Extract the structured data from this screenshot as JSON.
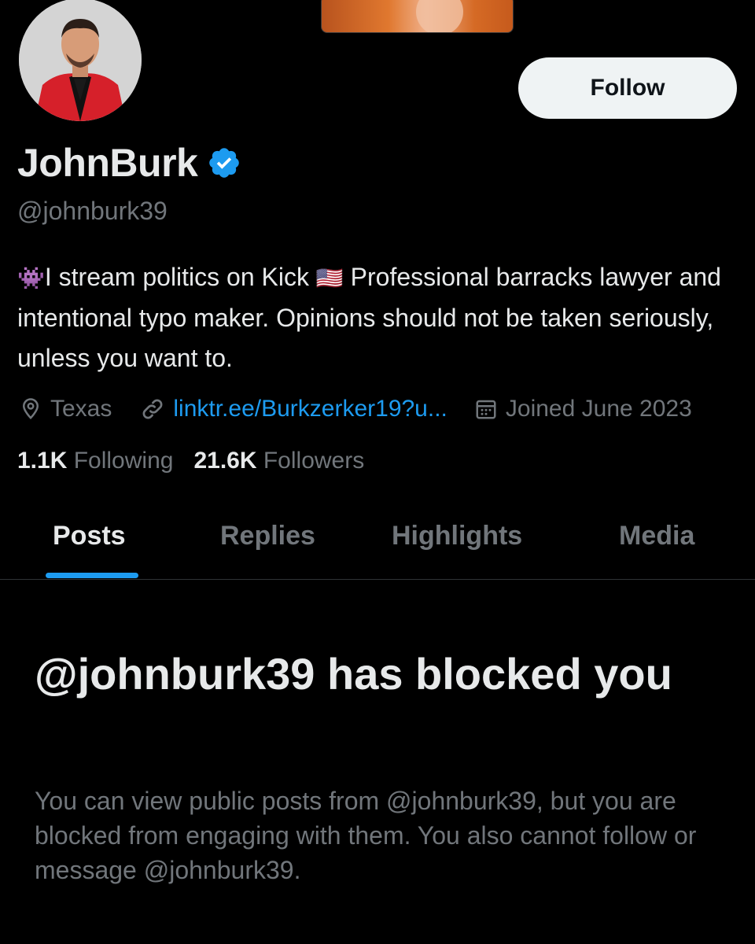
{
  "profile": {
    "display_name": "JohnBurk",
    "handle": "@johnburk39",
    "verified_icon": "verified-badge-icon",
    "follow_label": "Follow",
    "bio": {
      "emoji_lead": "👾",
      "text_1": "I stream politics on Kick ",
      "emoji_flag": "🇺🇸",
      "text_2": " Professional barracks lawyer and intentional typo maker. Opinions should not be taken seriously, unless you want to."
    },
    "location": "Texas",
    "link": "linktr.ee/Burkzerker19?u...",
    "joined": "Joined June 2023",
    "following_count": "1.1K",
    "following_label": "Following",
    "followers_count": "21.6K",
    "followers_label": "Followers"
  },
  "tabs": [
    {
      "label": "Posts",
      "active": true
    },
    {
      "label": "Replies",
      "active": false
    },
    {
      "label": "Highlights",
      "active": false
    },
    {
      "label": "Media",
      "active": false
    }
  ],
  "blocked": {
    "title": "@johnburk39 has blocked you",
    "description": "You can view public posts from @johnburk39, but you are blocked from engaging with them. You also cannot follow or message @johnburk39."
  },
  "colors": {
    "background": "#000000",
    "accent": "#1d9bf0",
    "text_primary": "#e7e9ea",
    "text_secondary": "#71767b"
  }
}
